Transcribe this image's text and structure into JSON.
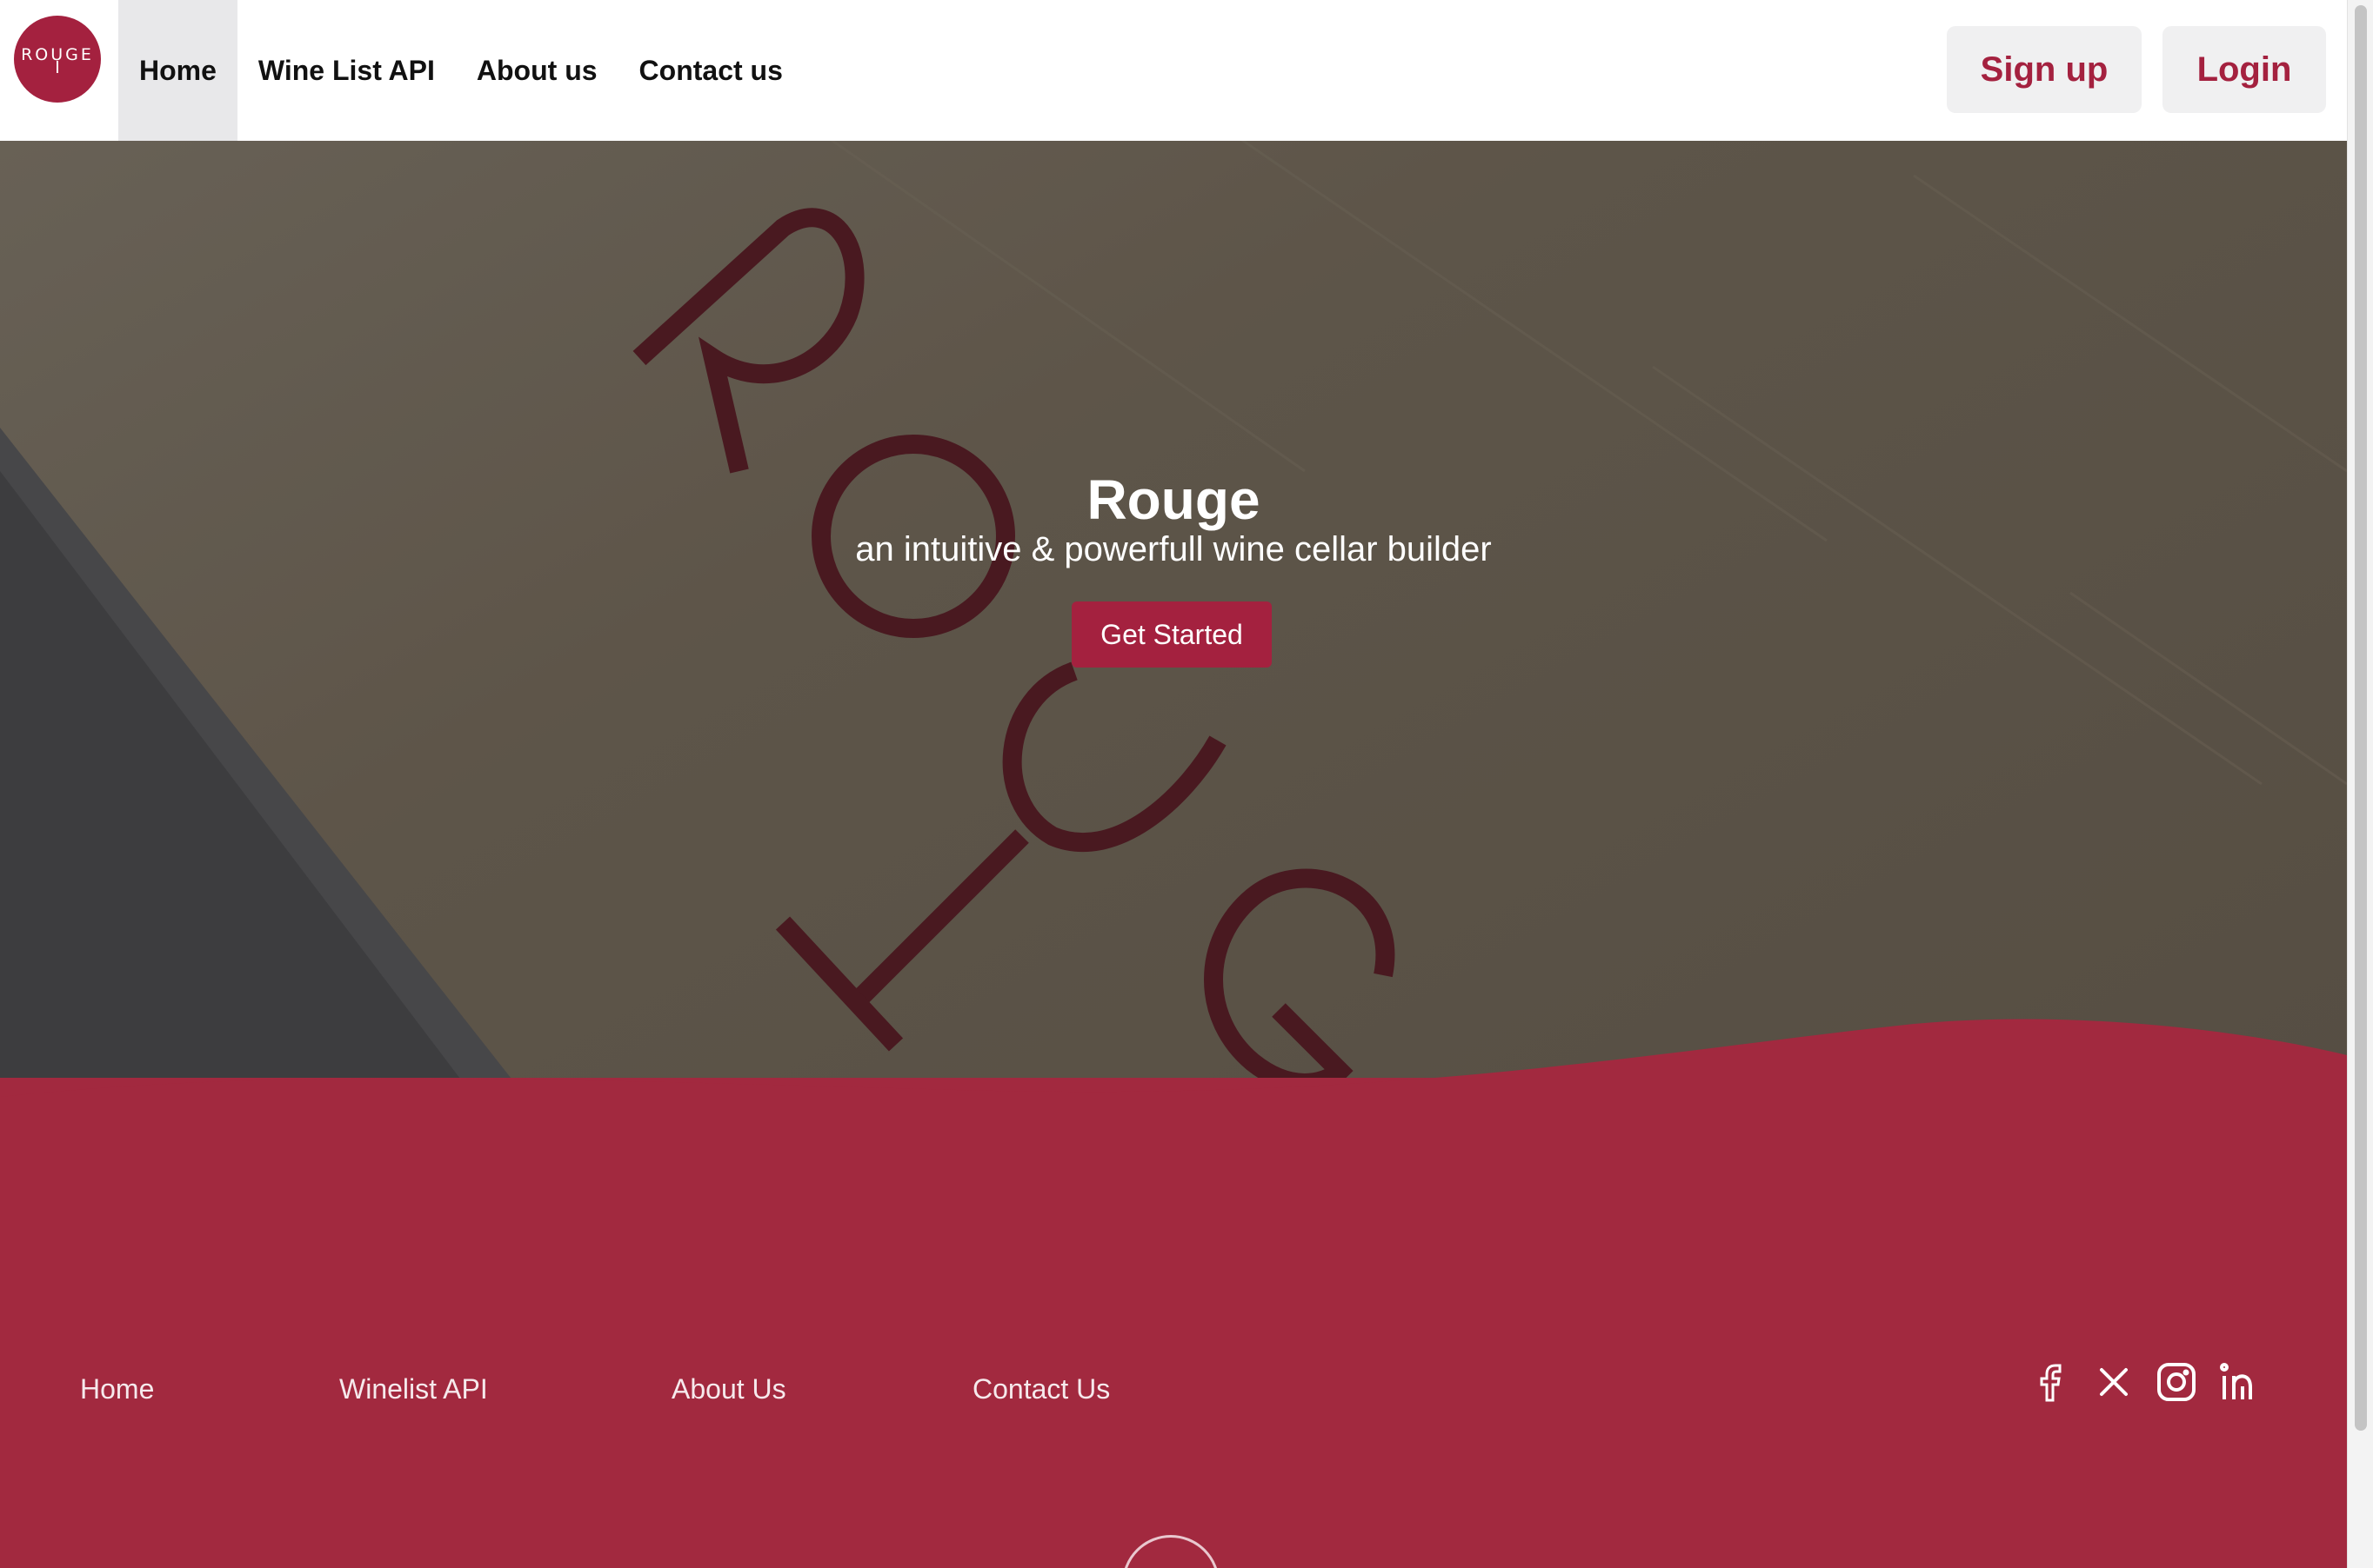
{
  "brand": {
    "logo_text": "ROUGE",
    "color": "#a4213f"
  },
  "nav": {
    "items": [
      {
        "label": "Home",
        "active": true
      },
      {
        "label": "Wine List API",
        "active": false
      },
      {
        "label": "About us",
        "active": false
      },
      {
        "label": "Contact us",
        "active": false
      }
    ],
    "signup_label": "Sign up",
    "login_label": "Login"
  },
  "hero": {
    "title": "Rouge",
    "subtitle": "an intuitive & powerfull wine cellar builder",
    "cta_label": "Get Started",
    "watermark_text": "ROUGE"
  },
  "footer": {
    "links": [
      "Home",
      "Winelist API",
      "About Us",
      "Contact Us"
    ],
    "social": [
      "facebook-icon",
      "x-icon",
      "instagram-icon",
      "linkedin-icon"
    ],
    "background": "#a2293f"
  }
}
